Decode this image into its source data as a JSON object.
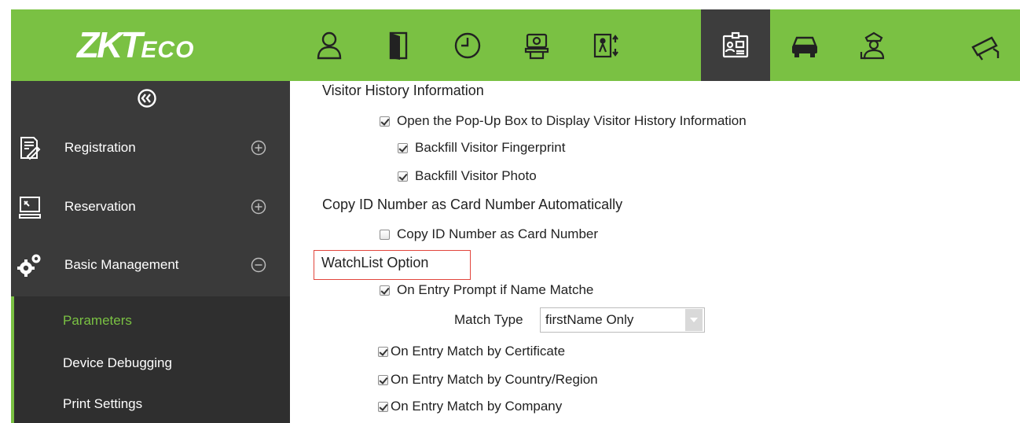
{
  "brand": {
    "logo_big": "ZKT",
    "logo_small": "ECO"
  },
  "topnav": {
    "items": [
      {
        "icon": "person-icon"
      },
      {
        "icon": "door-icon"
      },
      {
        "icon": "clock-icon"
      },
      {
        "icon": "hand-coin-icon"
      },
      {
        "icon": "elevator-icon"
      },
      {
        "icon": "visitor-id-card-icon",
        "active": true
      },
      {
        "icon": "car-icon"
      },
      {
        "icon": "guard-icon"
      },
      {
        "icon": "camera-icon"
      }
    ]
  },
  "sidebar": {
    "groups": [
      {
        "label": "Registration",
        "icon": "document-pen-icon",
        "state": "expand"
      },
      {
        "label": "Reservation",
        "icon": "monitor-icon",
        "state": "expand"
      },
      {
        "label": "Basic Management",
        "icon": "gears-icon",
        "state": "collapse"
      }
    ],
    "submenu": [
      {
        "label": "Parameters",
        "active": true
      },
      {
        "label": "Device Debugging"
      },
      {
        "label": "Print Settings"
      }
    ]
  },
  "content": {
    "visitor_history": {
      "title": "Visitor History Information",
      "popup": "Open the Pop-Up Box to Display Visitor History Information",
      "fingerprint": "Backfill Visitor Fingerprint",
      "photo": "Backfill Visitor Photo"
    },
    "copy_id": {
      "title": "Copy ID Number as Card Number Automatically",
      "option": "Copy ID Number as Card Number"
    },
    "watchlist": {
      "title": "WatchList Option",
      "name_match": "On Entry Prompt if Name Matche",
      "match_type_label": "Match Type",
      "match_type_value": "firstName Only",
      "certificate": "On Entry Match by Certificate",
      "country": "On Entry Match by Country/Region",
      "company": "On Entry Match by Company"
    }
  }
}
